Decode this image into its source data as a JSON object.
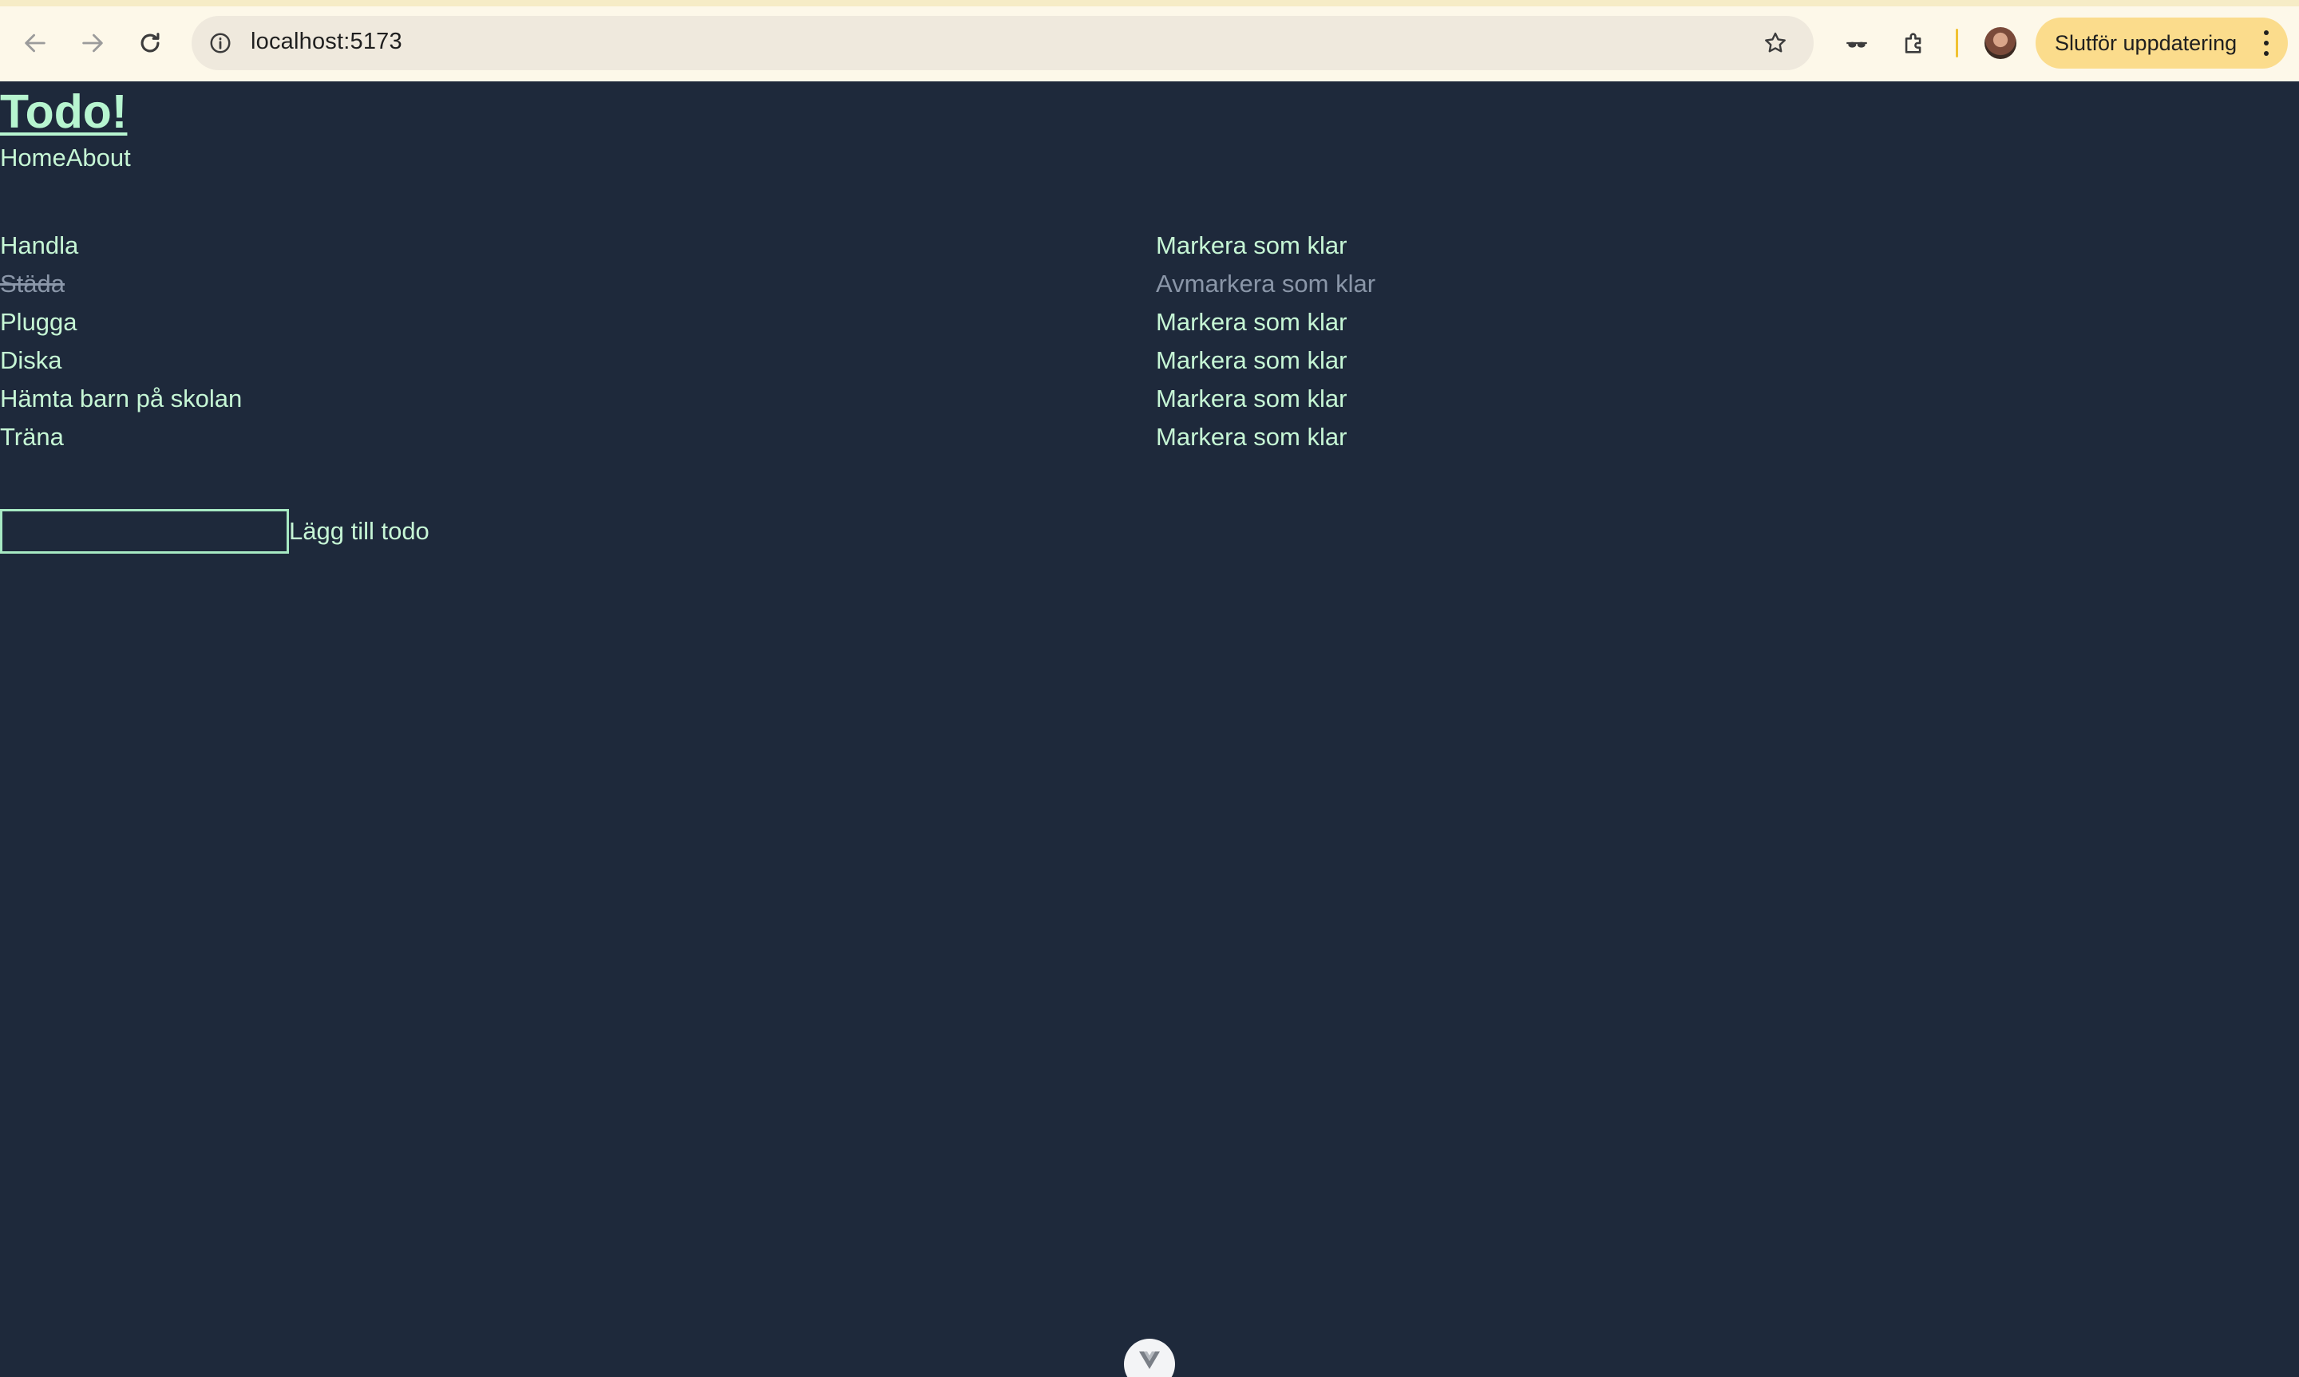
{
  "browser": {
    "url": "localhost:5173",
    "update_button_label": "Slutför uppdatering",
    "icons": {
      "back": "arrow-left-icon",
      "forward": "arrow-right-icon",
      "reload": "reload-icon",
      "site_info": "info-icon",
      "bookmark": "star-icon",
      "incognito": "glasses-icon",
      "extensions": "puzzle-icon",
      "profile": "avatar",
      "menu": "more-vertical-icon"
    },
    "accent_color": "#fbdc8c"
  },
  "app": {
    "title": "Todo!",
    "nav": [
      {
        "label": "Home"
      },
      {
        "label": "About"
      }
    ],
    "todos": [
      {
        "name": "Handla",
        "done": false,
        "action": "Markera som klar"
      },
      {
        "name": "Städa",
        "done": true,
        "action": "Avmarkera som klar"
      },
      {
        "name": "Plugga",
        "done": false,
        "action": "Markera som klar"
      },
      {
        "name": "Diska",
        "done": false,
        "action": "Markera som klar"
      },
      {
        "name": "Hämta barn på skolan",
        "done": false,
        "action": "Markera som klar"
      },
      {
        "name": "Träna",
        "done": false,
        "action": "Markera som klar"
      }
    ],
    "add_form": {
      "input_value": "",
      "button_label": "Lägg till todo"
    },
    "colors": {
      "background": "#1e293b",
      "text": "#c6f6d5",
      "done_text": "#8a96a8"
    }
  }
}
